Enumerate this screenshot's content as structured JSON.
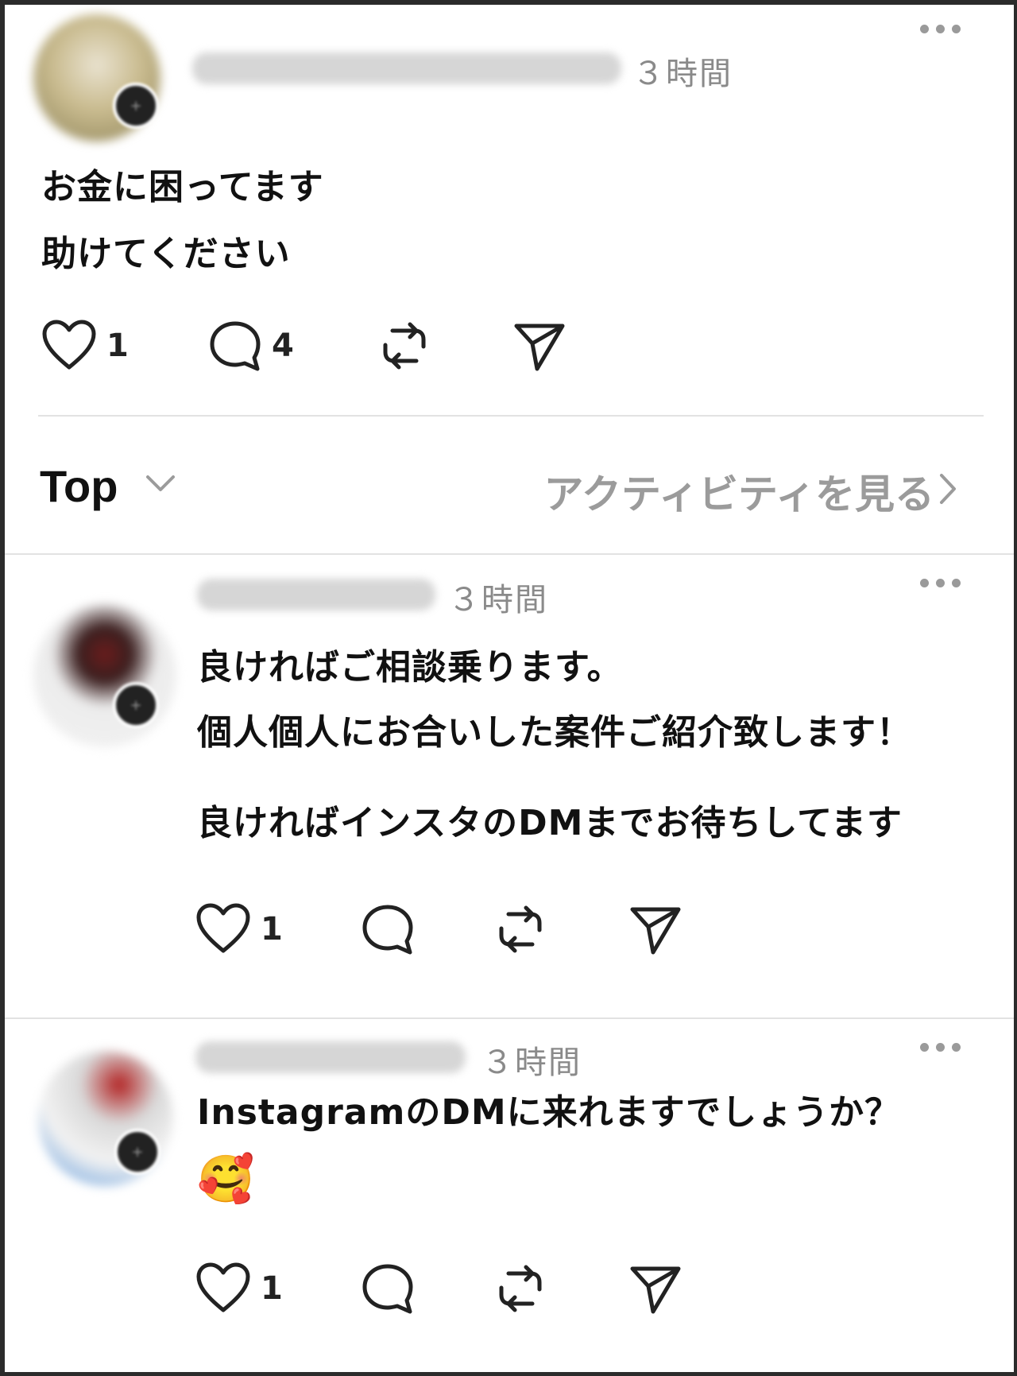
{
  "original_post": {
    "time": "３時間",
    "lines": [
      "お金に困ってます",
      "助けてください"
    ],
    "like_count": "1",
    "comment_count": "4"
  },
  "sort_bar": {
    "sort_label": "Top",
    "activity_link": "アクティビティを見る"
  },
  "replies": [
    {
      "time": "３時間",
      "lines": [
        "良ければご相談乗ります。",
        "個人個人にお合いした案件ご紹介致します！",
        "",
        "良ければインスタのDMまでお待ちしてます"
      ],
      "like_count": "1"
    },
    {
      "time": "３時間",
      "lines": [
        "InstagramのDMに来れますでしょうか？"
      ],
      "emoji": "🥰",
      "like_count": "1"
    }
  ],
  "icons": [
    "more-icon",
    "heart-icon",
    "comment-icon",
    "repost-icon",
    "share-icon",
    "chevron-down-icon",
    "chevron-right-icon"
  ]
}
